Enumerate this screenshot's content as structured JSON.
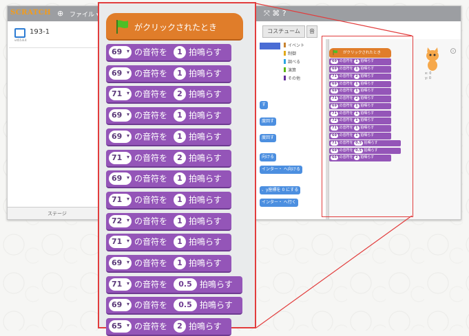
{
  "app": {
    "logo": "SCRATCH",
    "file_menu": "ファイル ▾",
    "project_name": "193-1",
    "project_version": "v455.8.4",
    "tab_costumes": "コスチューム",
    "tab_sounds": "音",
    "stage_footer_label": "ステージ",
    "sprite_xy": [
      "x: 0",
      "y: 0"
    ]
  },
  "categories": [
    {
      "label": "イベント",
      "color": "#c88330"
    },
    {
      "label": "制御",
      "color": "#e1a91a"
    },
    {
      "label": "調べる",
      "color": "#2ca5e2"
    },
    {
      "label": "演算",
      "color": "#5cb712"
    },
    {
      "label": "その他",
      "color": "#632d99"
    }
  ],
  "palette_blocks": [
    "す",
    "度回す",
    "度回す",
    "向ける",
    "インター・ へ向ける",
    "、y座標を 0 にする",
    "インター・ へ行く"
  ],
  "script": {
    "hat": "がクリックされたとき",
    "of_note": "の音符を",
    "beats_suffix": "拍鳴らす",
    "blocks": [
      {
        "note": "69",
        "beats": "1"
      },
      {
        "note": "69",
        "beats": "1"
      },
      {
        "note": "71",
        "beats": "2"
      },
      {
        "note": "69",
        "beats": "1"
      },
      {
        "note": "69",
        "beats": "1"
      },
      {
        "note": "71",
        "beats": "2"
      },
      {
        "note": "69",
        "beats": "1"
      },
      {
        "note": "71",
        "beats": "1"
      },
      {
        "note": "72",
        "beats": "1"
      },
      {
        "note": "71",
        "beats": "1"
      },
      {
        "note": "69",
        "beats": "1"
      },
      {
        "note": "71",
        "beats": "0.5"
      },
      {
        "note": "69",
        "beats": "0.5"
      },
      {
        "note": "65",
        "beats": "2"
      }
    ]
  },
  "colors": {
    "event": "#e07d2a",
    "sound": "#9455b8",
    "highlight": "#e23c3c"
  }
}
